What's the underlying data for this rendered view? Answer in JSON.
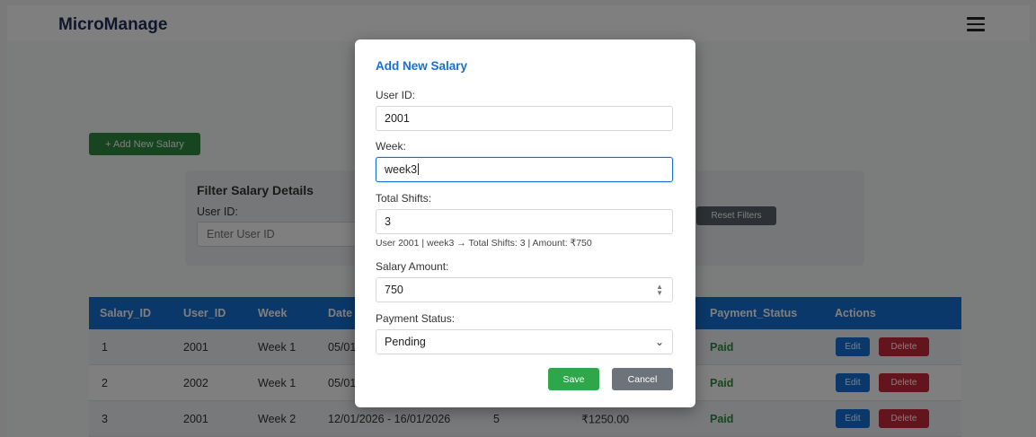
{
  "app": {
    "brand": "MicroManage"
  },
  "page": {
    "add_button": "+ Add New Salary"
  },
  "filter": {
    "title": "Filter Salary Details",
    "user_id_label": "User ID:",
    "user_id_placeholder": "Enter User ID",
    "reset_button": "Reset Filters"
  },
  "table": {
    "headers": [
      "Salary_ID",
      "User_ID",
      "Week",
      "Date",
      "",
      "",
      "Payment_Status",
      "Actions"
    ],
    "rows": [
      {
        "salary_id": "1",
        "user_id": "2001",
        "week": "Week 1",
        "date": "05/01",
        "shifts": "",
        "amount": "",
        "status": "Paid"
      },
      {
        "salary_id": "2",
        "user_id": "2002",
        "week": "Week 1",
        "date": "05/01",
        "shifts": "",
        "amount": "",
        "status": "Paid"
      },
      {
        "salary_id": "3",
        "user_id": "2001",
        "week": "Week 2",
        "date": "12/01/2026 - 16/01/2026",
        "shifts": "5",
        "amount": "₹1250.00",
        "status": "Paid"
      }
    ],
    "edit_label": "Edit",
    "delete_label": "Delete"
  },
  "modal": {
    "title": "Add New Salary",
    "user_id_label": "User ID:",
    "user_id_value": "2001",
    "week_label": "Week:",
    "week_value": "week3",
    "shifts_label": "Total Shifts:",
    "shifts_value": "3",
    "info_text": "User 2001 | week3 → Total Shifts: 3 | Amount: ₹750",
    "amount_label": "Salary Amount:",
    "amount_value": "750",
    "status_label": "Payment Status:",
    "status_value": "Pending",
    "save_button": "Save",
    "cancel_button": "Cancel"
  },
  "colors": {
    "primary": "#1670d4",
    "success": "#2e8b3e",
    "danger": "#c8283a",
    "secondary": "#6c737b"
  },
  "icons": {
    "menu": "hamburger-menu-icon",
    "spinner": "number-spinner-icon",
    "select": "chevron-down-icon"
  }
}
